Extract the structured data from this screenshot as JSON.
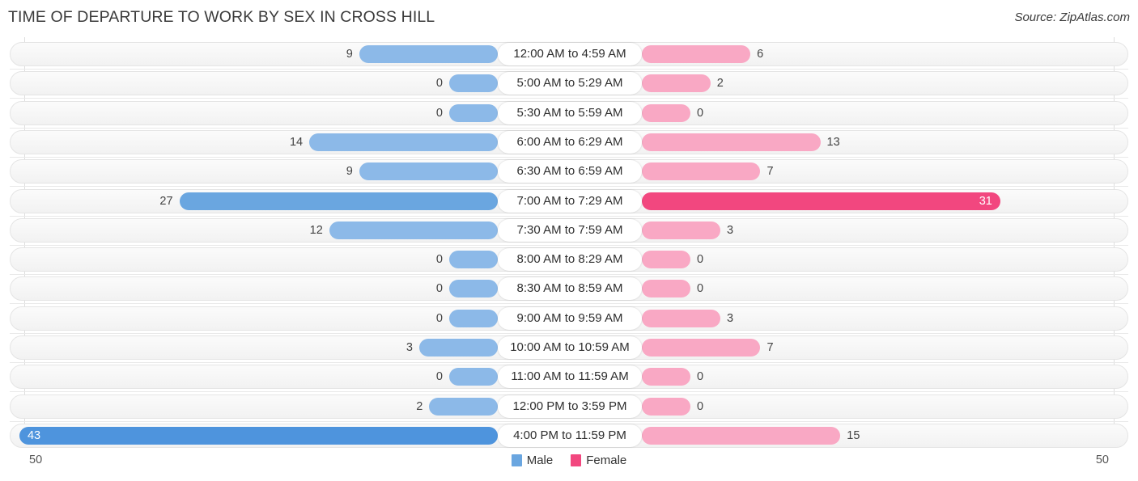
{
  "header": {
    "title": "TIME OF DEPARTURE TO WORK BY SEX IN CROSS HILL",
    "source": "Source: ZipAtlas.com"
  },
  "legend": {
    "male_label": "Male",
    "female_label": "Female",
    "male_color": "#6aa6e0",
    "female_color": "#f2477f"
  },
  "axis": {
    "left_max": "50",
    "right_max": "50"
  },
  "chart_data": {
    "type": "bar",
    "title": "TIME OF DEPARTURE TO WORK BY SEX IN CROSS HILL",
    "subtype": "diverging-bidirectional-bar",
    "xlabel": "",
    "ylabel": "",
    "xlim": [
      50,
      50
    ],
    "grid": false,
    "legend_position": "bottom-center",
    "categories": [
      "12:00 AM to 4:59 AM",
      "5:00 AM to 5:29 AM",
      "5:30 AM to 5:59 AM",
      "6:00 AM to 6:29 AM",
      "6:30 AM to 6:59 AM",
      "7:00 AM to 7:29 AM",
      "7:30 AM to 7:59 AM",
      "8:00 AM to 8:29 AM",
      "8:30 AM to 8:59 AM",
      "9:00 AM to 9:59 AM",
      "10:00 AM to 10:59 AM",
      "11:00 AM to 11:59 AM",
      "12:00 PM to 3:59 PM",
      "4:00 PM to 11:59 PM"
    ],
    "series": [
      {
        "name": "Male",
        "color": "#6aa6e0",
        "direction": "left",
        "values": [
          9,
          0,
          0,
          14,
          9,
          27,
          12,
          0,
          0,
          0,
          3,
          0,
          2,
          43
        ]
      },
      {
        "name": "Female",
        "color": "#f2477f",
        "direction": "right",
        "values": [
          6,
          2,
          0,
          13,
          7,
          31,
          3,
          0,
          0,
          3,
          7,
          0,
          0,
          15
        ]
      }
    ]
  }
}
